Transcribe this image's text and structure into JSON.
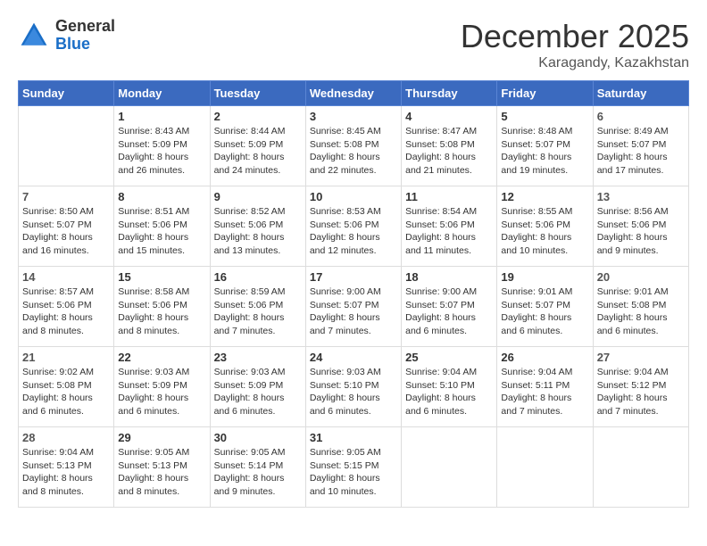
{
  "logo": {
    "general": "General",
    "blue": "Blue"
  },
  "header": {
    "month": "December 2025",
    "location": "Karagandy, Kazakhstan"
  },
  "weekdays": [
    "Sunday",
    "Monday",
    "Tuesday",
    "Wednesday",
    "Thursday",
    "Friday",
    "Saturday"
  ],
  "weeks": [
    [
      {
        "day": "",
        "sunrise": "",
        "sunset": "",
        "daylight": ""
      },
      {
        "day": "1",
        "sunrise": "Sunrise: 8:43 AM",
        "sunset": "Sunset: 5:09 PM",
        "daylight": "Daylight: 8 hours and 26 minutes."
      },
      {
        "day": "2",
        "sunrise": "Sunrise: 8:44 AM",
        "sunset": "Sunset: 5:09 PM",
        "daylight": "Daylight: 8 hours and 24 minutes."
      },
      {
        "day": "3",
        "sunrise": "Sunrise: 8:45 AM",
        "sunset": "Sunset: 5:08 PM",
        "daylight": "Daylight: 8 hours and 22 minutes."
      },
      {
        "day": "4",
        "sunrise": "Sunrise: 8:47 AM",
        "sunset": "Sunset: 5:08 PM",
        "daylight": "Daylight: 8 hours and 21 minutes."
      },
      {
        "day": "5",
        "sunrise": "Sunrise: 8:48 AM",
        "sunset": "Sunset: 5:07 PM",
        "daylight": "Daylight: 8 hours and 19 minutes."
      },
      {
        "day": "6",
        "sunrise": "Sunrise: 8:49 AM",
        "sunset": "Sunset: 5:07 PM",
        "daylight": "Daylight: 8 hours and 17 minutes."
      }
    ],
    [
      {
        "day": "7",
        "sunrise": "Sunrise: 8:50 AM",
        "sunset": "Sunset: 5:07 PM",
        "daylight": "Daylight: 8 hours and 16 minutes."
      },
      {
        "day": "8",
        "sunrise": "Sunrise: 8:51 AM",
        "sunset": "Sunset: 5:06 PM",
        "daylight": "Daylight: 8 hours and 15 minutes."
      },
      {
        "day": "9",
        "sunrise": "Sunrise: 8:52 AM",
        "sunset": "Sunset: 5:06 PM",
        "daylight": "Daylight: 8 hours and 13 minutes."
      },
      {
        "day": "10",
        "sunrise": "Sunrise: 8:53 AM",
        "sunset": "Sunset: 5:06 PM",
        "daylight": "Daylight: 8 hours and 12 minutes."
      },
      {
        "day": "11",
        "sunrise": "Sunrise: 8:54 AM",
        "sunset": "Sunset: 5:06 PM",
        "daylight": "Daylight: 8 hours and 11 minutes."
      },
      {
        "day": "12",
        "sunrise": "Sunrise: 8:55 AM",
        "sunset": "Sunset: 5:06 PM",
        "daylight": "Daylight: 8 hours and 10 minutes."
      },
      {
        "day": "13",
        "sunrise": "Sunrise: 8:56 AM",
        "sunset": "Sunset: 5:06 PM",
        "daylight": "Daylight: 8 hours and 9 minutes."
      }
    ],
    [
      {
        "day": "14",
        "sunrise": "Sunrise: 8:57 AM",
        "sunset": "Sunset: 5:06 PM",
        "daylight": "Daylight: 8 hours and 8 minutes."
      },
      {
        "day": "15",
        "sunrise": "Sunrise: 8:58 AM",
        "sunset": "Sunset: 5:06 PM",
        "daylight": "Daylight: 8 hours and 8 minutes."
      },
      {
        "day": "16",
        "sunrise": "Sunrise: 8:59 AM",
        "sunset": "Sunset: 5:06 PM",
        "daylight": "Daylight: 8 hours and 7 minutes."
      },
      {
        "day": "17",
        "sunrise": "Sunrise: 9:00 AM",
        "sunset": "Sunset: 5:07 PM",
        "daylight": "Daylight: 8 hours and 7 minutes."
      },
      {
        "day": "18",
        "sunrise": "Sunrise: 9:00 AM",
        "sunset": "Sunset: 5:07 PM",
        "daylight": "Daylight: 8 hours and 6 minutes."
      },
      {
        "day": "19",
        "sunrise": "Sunrise: 9:01 AM",
        "sunset": "Sunset: 5:07 PM",
        "daylight": "Daylight: 8 hours and 6 minutes."
      },
      {
        "day": "20",
        "sunrise": "Sunrise: 9:01 AM",
        "sunset": "Sunset: 5:08 PM",
        "daylight": "Daylight: 8 hours and 6 minutes."
      }
    ],
    [
      {
        "day": "21",
        "sunrise": "Sunrise: 9:02 AM",
        "sunset": "Sunset: 5:08 PM",
        "daylight": "Daylight: 8 hours and 6 minutes."
      },
      {
        "day": "22",
        "sunrise": "Sunrise: 9:03 AM",
        "sunset": "Sunset: 5:09 PM",
        "daylight": "Daylight: 8 hours and 6 minutes."
      },
      {
        "day": "23",
        "sunrise": "Sunrise: 9:03 AM",
        "sunset": "Sunset: 5:09 PM",
        "daylight": "Daylight: 8 hours and 6 minutes."
      },
      {
        "day": "24",
        "sunrise": "Sunrise: 9:03 AM",
        "sunset": "Sunset: 5:10 PM",
        "daylight": "Daylight: 8 hours and 6 minutes."
      },
      {
        "day": "25",
        "sunrise": "Sunrise: 9:04 AM",
        "sunset": "Sunset: 5:10 PM",
        "daylight": "Daylight: 8 hours and 6 minutes."
      },
      {
        "day": "26",
        "sunrise": "Sunrise: 9:04 AM",
        "sunset": "Sunset: 5:11 PM",
        "daylight": "Daylight: 8 hours and 7 minutes."
      },
      {
        "day": "27",
        "sunrise": "Sunrise: 9:04 AM",
        "sunset": "Sunset: 5:12 PM",
        "daylight": "Daylight: 8 hours and 7 minutes."
      }
    ],
    [
      {
        "day": "28",
        "sunrise": "Sunrise: 9:04 AM",
        "sunset": "Sunset: 5:13 PM",
        "daylight": "Daylight: 8 hours and 8 minutes."
      },
      {
        "day": "29",
        "sunrise": "Sunrise: 9:05 AM",
        "sunset": "Sunset: 5:13 PM",
        "daylight": "Daylight: 8 hours and 8 minutes."
      },
      {
        "day": "30",
        "sunrise": "Sunrise: 9:05 AM",
        "sunset": "Sunset: 5:14 PM",
        "daylight": "Daylight: 8 hours and 9 minutes."
      },
      {
        "day": "31",
        "sunrise": "Sunrise: 9:05 AM",
        "sunset": "Sunset: 5:15 PM",
        "daylight": "Daylight: 8 hours and 10 minutes."
      },
      {
        "day": "",
        "sunrise": "",
        "sunset": "",
        "daylight": ""
      },
      {
        "day": "",
        "sunrise": "",
        "sunset": "",
        "daylight": ""
      },
      {
        "day": "",
        "sunrise": "",
        "sunset": "",
        "daylight": ""
      }
    ]
  ]
}
